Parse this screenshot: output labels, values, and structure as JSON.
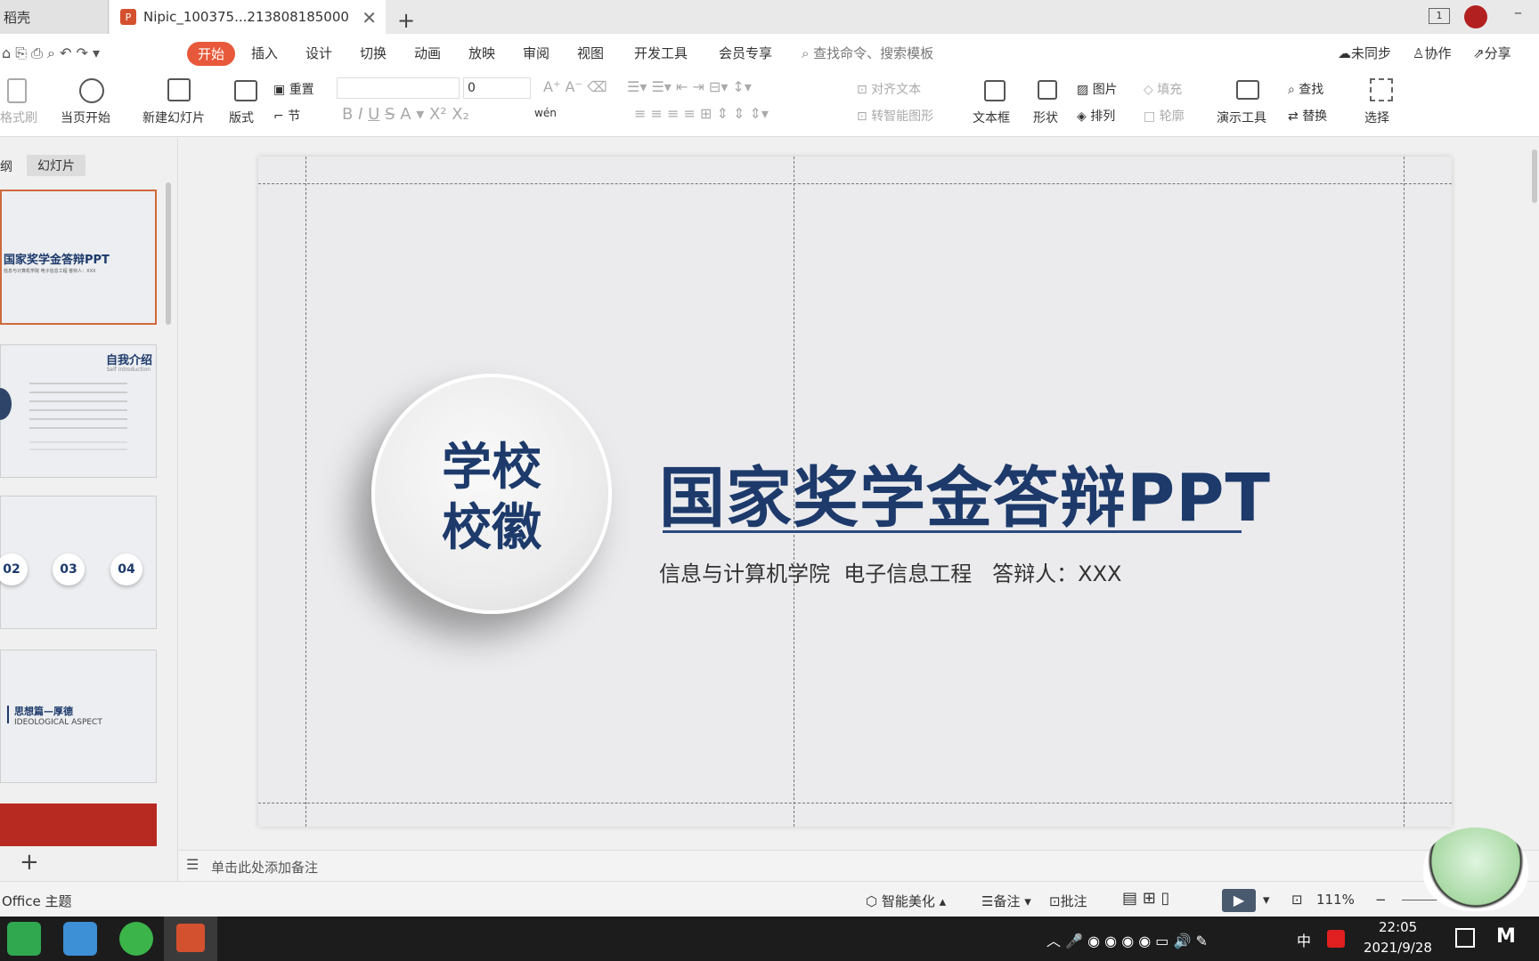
{
  "tabs": {
    "tab1_label": "稻壳",
    "tab2_label": "Nipic_100375...213808185000",
    "tab2_badge": "P",
    "new_tab": "+"
  },
  "window": {
    "page_indicator": "1"
  },
  "menu": {
    "start": "开始",
    "insert": "插入",
    "design": "设计",
    "switch": "切换",
    "animation": "动画",
    "show": "放映",
    "review": "审阅",
    "view": "视图",
    "dev": "开发工具",
    "member": "会员专享",
    "search_placeholder": "查找命令、搜索模板",
    "unsync": "未同步",
    "collab": "协作",
    "share": "分享"
  },
  "ribbon": {
    "format_brush": "格式刷",
    "play_current": "当页开始",
    "new_slide": "新建幻灯片",
    "layout": "版式",
    "reset": "重置",
    "section": "节",
    "font_size": "0",
    "align_text": "对齐文本",
    "smart_shape": "转智能图形",
    "textbox": "文本框",
    "shape": "形状",
    "picture": "图片",
    "arrange": "排列",
    "fill": "填充",
    "outline": "轮廓",
    "present_tool": "演示工具",
    "find": "查找",
    "replace": "替换",
    "select": "选择",
    "wen": "wén"
  },
  "leftpanel": {
    "tab_outline": "纲",
    "tab_slides": "幻灯片",
    "thumb1_title": "国家奖学金答辩PPT",
    "thumb1_sub": "信息与计算机学院 电子信息工程 答辩人：XXX",
    "thumb2_title": "自我介绍",
    "thumb2_sub": "Self introduction",
    "thumb3_nums": [
      "02",
      "03",
      "04"
    ],
    "thumb4_title": "思想篇—厚德",
    "thumb4_sub": "IDEOLOGICAL ASPECT",
    "add_slide": "+"
  },
  "slide": {
    "badge_line1": "学校",
    "badge_line2": "校徽",
    "title": "国家奖学金答辩PPT",
    "subtitle": "信息与计算机学院  电子信息工程   答辩人：XXX"
  },
  "notes": {
    "placeholder": "单击此处添加备注"
  },
  "status": {
    "theme": "Office 主题",
    "beautify": "智能美化",
    "notes": "备注",
    "comment": "批注",
    "zoom": "111%"
  },
  "taskbar": {
    "ime": "中",
    "time": "22:05",
    "date": "2021/9/28"
  },
  "colors": {
    "accent": "#e8583a",
    "title": "#1d3a6b"
  }
}
